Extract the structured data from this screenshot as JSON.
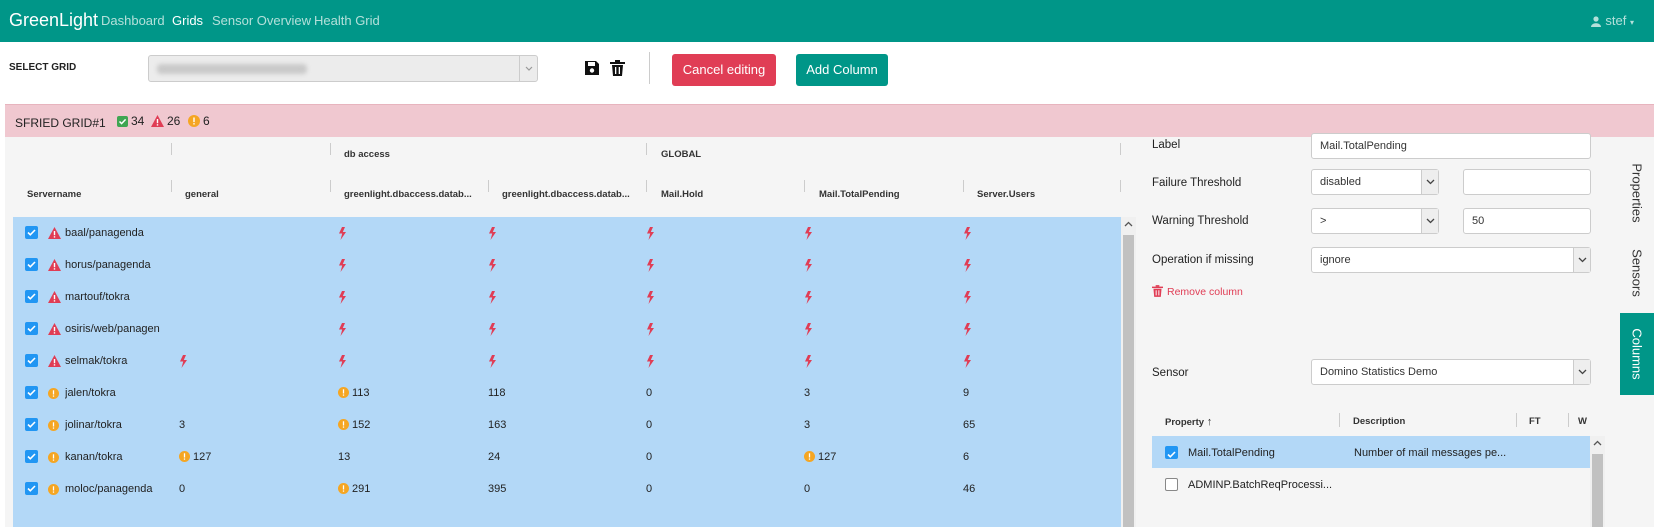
{
  "nav": {
    "brand": "GreenLight",
    "links": [
      "Dashboard",
      "Grids",
      "Sensor Overview",
      "Health Grid"
    ],
    "active": "Grids",
    "user": "stef"
  },
  "toolbar": {
    "select_grid_label": "SELECT GRID",
    "cancel_label": "Cancel editing",
    "add_column_label": "Add Column"
  },
  "grid": {
    "title": "SFRIED GRID#1",
    "ok_count": "34",
    "error_count": "26",
    "warning_count": "6"
  },
  "table": {
    "groups": [
      "db access",
      "GLOBAL"
    ],
    "columns": [
      "Servername",
      "general",
      "greenlight.dbaccess.datab...",
      "greenlight.dbaccess.datab...",
      "Mail.Hold",
      "Mail.TotalPending",
      "Server.Users"
    ],
    "rows": [
      {
        "status": "error",
        "name": "baal/panagenda",
        "cells": [
          {
            "t": ""
          },
          {
            "t": "",
            "icon": "bolt"
          },
          {
            "t": "",
            "icon": "bolt"
          },
          {
            "t": "",
            "icon": "bolt"
          },
          {
            "t": "",
            "icon": "bolt"
          },
          {
            "t": "",
            "icon": "bolt"
          }
        ]
      },
      {
        "status": "error",
        "name": "horus/panagenda",
        "cells": [
          {
            "t": ""
          },
          {
            "t": "",
            "icon": "bolt"
          },
          {
            "t": "",
            "icon": "bolt"
          },
          {
            "t": "",
            "icon": "bolt"
          },
          {
            "t": "",
            "icon": "bolt"
          },
          {
            "t": "",
            "icon": "bolt"
          }
        ]
      },
      {
        "status": "error",
        "name": "martouf/tokra",
        "cells": [
          {
            "t": ""
          },
          {
            "t": "",
            "icon": "bolt"
          },
          {
            "t": "",
            "icon": "bolt"
          },
          {
            "t": "",
            "icon": "bolt"
          },
          {
            "t": "",
            "icon": "bolt"
          },
          {
            "t": "",
            "icon": "bolt"
          }
        ]
      },
      {
        "status": "error",
        "name": "osiris/web/panagenda",
        "cells": [
          {
            "t": ""
          },
          {
            "t": "",
            "icon": "bolt"
          },
          {
            "t": "",
            "icon": "bolt"
          },
          {
            "t": "",
            "icon": "bolt"
          },
          {
            "t": "",
            "icon": "bolt"
          },
          {
            "t": "",
            "icon": "bolt"
          }
        ]
      },
      {
        "status": "error",
        "name": "selmak/tokra",
        "cells": [
          {
            "t": "",
            "icon": "bolt"
          },
          {
            "t": "",
            "icon": "bolt"
          },
          {
            "t": "",
            "icon": "bolt"
          },
          {
            "t": "",
            "icon": "bolt"
          },
          {
            "t": "",
            "icon": "bolt"
          },
          {
            "t": "",
            "icon": "bolt"
          }
        ]
      },
      {
        "status": "warning",
        "name": "jalen/tokra",
        "cells": [
          {
            "t": ""
          },
          {
            "t": "113",
            "icon": "warn"
          },
          {
            "t": "118"
          },
          {
            "t": "0"
          },
          {
            "t": "3"
          },
          {
            "t": "9"
          }
        ]
      },
      {
        "status": "warning",
        "name": "jolinar/tokra",
        "cells": [
          {
            "t": "3"
          },
          {
            "t": "152",
            "icon": "warn"
          },
          {
            "t": "163"
          },
          {
            "t": "0"
          },
          {
            "t": "3"
          },
          {
            "t": "65"
          }
        ]
      },
      {
        "status": "warning",
        "name": "kanan/tokra",
        "cells": [
          {
            "t": "127",
            "icon": "warn"
          },
          {
            "t": "13"
          },
          {
            "t": "24"
          },
          {
            "t": "0"
          },
          {
            "t": "127",
            "icon": "warn"
          },
          {
            "t": "6"
          }
        ]
      },
      {
        "status": "warning",
        "name": "moloc/panagenda",
        "cells": [
          {
            "t": "0"
          },
          {
            "t": "291",
            "icon": "warn"
          },
          {
            "t": "395"
          },
          {
            "t": "0"
          },
          {
            "t": "0"
          },
          {
            "t": "46"
          }
        ]
      }
    ]
  },
  "panel": {
    "label_label": "Label",
    "label_value": "Mail.TotalPending",
    "failure_label": "Failure Threshold",
    "failure_op": "disabled",
    "failure_value": "",
    "warning_label": "Warning Threshold",
    "warning_op": ">",
    "warning_value": "50",
    "missing_label": "Operation if missing",
    "missing_value": "ignore",
    "remove_label": "Remove column",
    "sensor_label": "Sensor",
    "sensor_value": "Domino Statistics Demo",
    "prop_headers": [
      "Property",
      "Description",
      "FT",
      "W"
    ],
    "properties": [
      {
        "name": "Mail.TotalPending",
        "desc": "Number of mail messages pe...",
        "checked": true
      },
      {
        "name": "ADMINP.BatchReqProcessi...",
        "desc": "",
        "checked": false
      }
    ]
  },
  "side_tabs": [
    "Properties",
    "Sensors",
    "Columns"
  ],
  "colors": {
    "accent": "#009688",
    "danger": "#e03d55",
    "warning": "#f5a623",
    "selected": "#b3d8f7"
  }
}
